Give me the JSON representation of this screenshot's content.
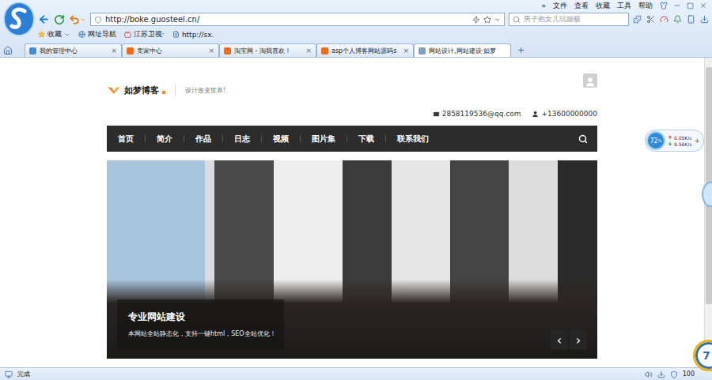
{
  "browser": {
    "menu": [
      "»",
      "文件",
      "查看",
      "收藏",
      "工具",
      "帮助"
    ],
    "address": "http://boke.guosteel.cn/",
    "search_placeholder": "男子抱女儿玩蹦极",
    "bookmarks": [
      "收藏",
      "网址导航",
      "江苏卫视·",
      "http://sx."
    ],
    "tab_close": "×",
    "new_tab": "+",
    "tabs": [
      {
        "label": "我的管理中心",
        "selected": false,
        "closable": true,
        "color": "#3f8fd8"
      },
      {
        "label": "卖家中心",
        "selected": false,
        "closable": true,
        "color": "#f26a1b"
      },
      {
        "label": "淘宝网 - 淘我喜欢！",
        "selected": false,
        "closable": true,
        "color": "#f26a1b"
      },
      {
        "label": "asp个人博客网站源码s",
        "selected": false,
        "closable": true,
        "color": "#f26a1b"
      },
      {
        "label": "网站设计,网站建设·如梦",
        "selected": true,
        "closable": false,
        "color": "#7f9fc4"
      }
    ]
  },
  "page": {
    "logo": "如梦博客",
    "slogan": "设计改变世界!",
    "email": "2858119536@qq.com",
    "phone": "+13600000000",
    "nav": [
      "首页",
      "简介",
      "作品",
      "日志",
      "视频",
      "图片集",
      "下载",
      "联系我们"
    ],
    "banner": {
      "title": "专业网站建设",
      "subtitle": "本网站全站静态化，支持一键html，SEO全站优化！",
      "prev": "‹",
      "next": "›"
    }
  },
  "speed_widget": {
    "percent": "72",
    "percent_sign": "%",
    "upload": "0.05K/s",
    "download": "9.56K/s",
    "plus": "+"
  },
  "corner_badge": "7",
  "status_bar": {
    "text": "完成",
    "zoom": "100"
  }
}
